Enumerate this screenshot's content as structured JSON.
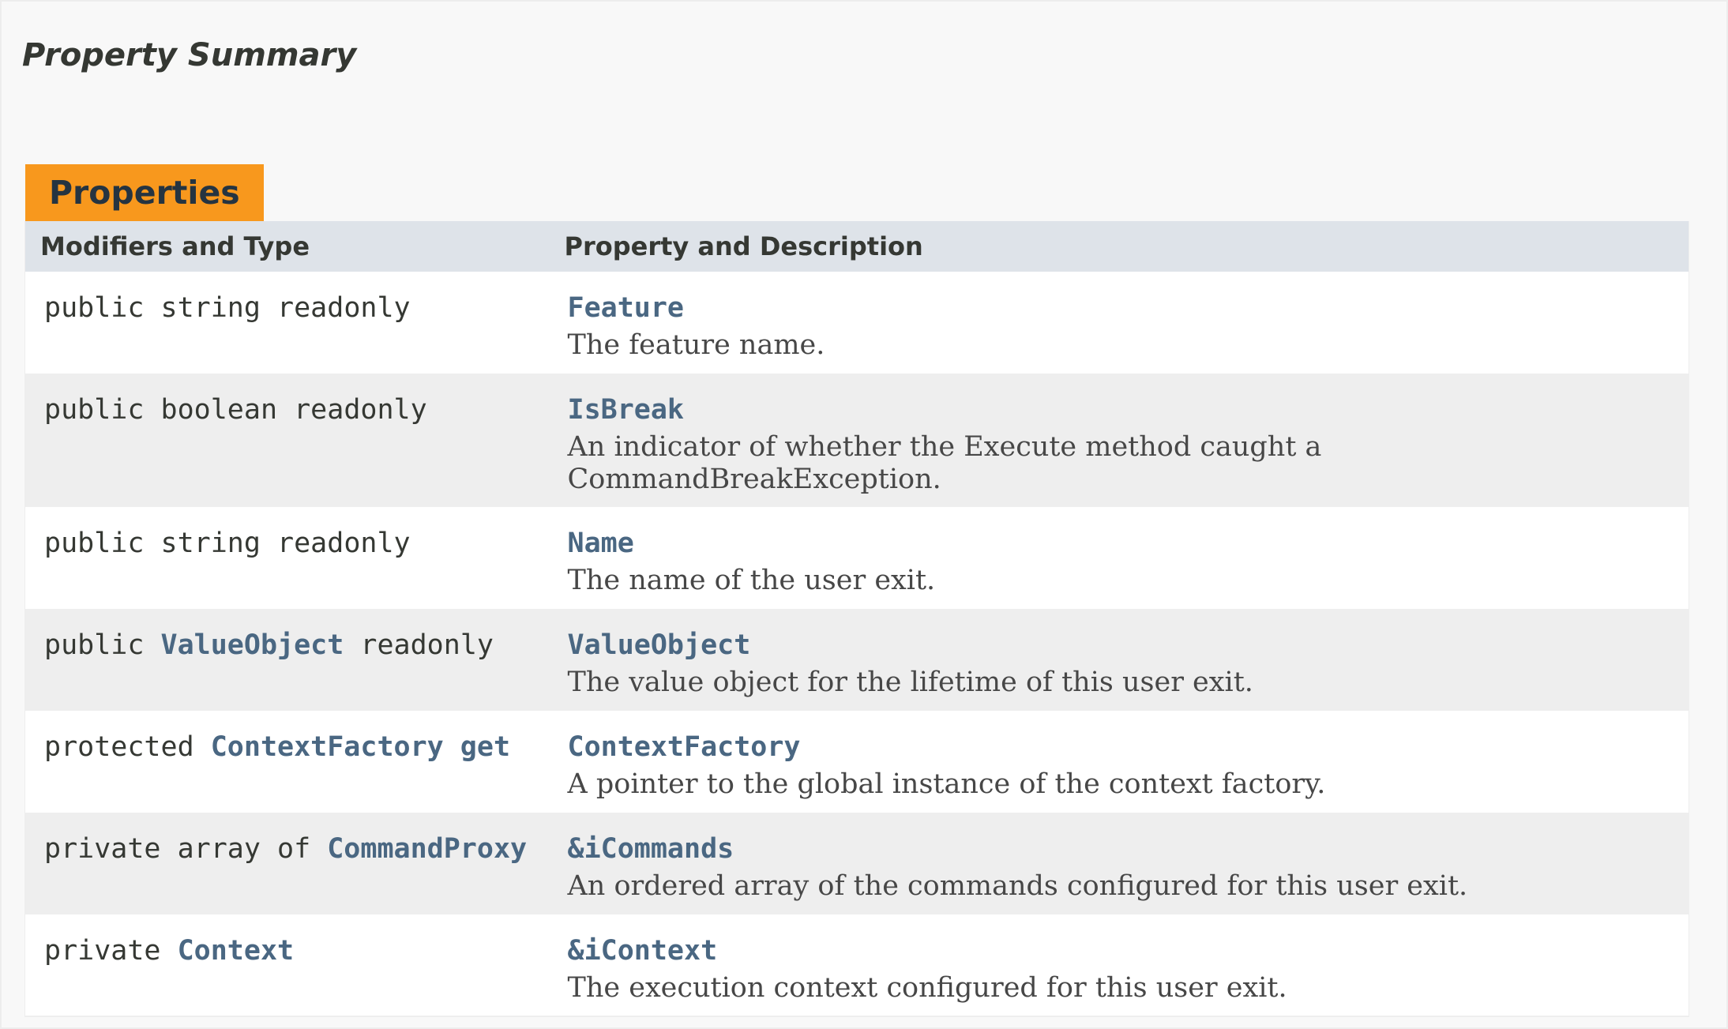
{
  "summary": {
    "title": "Property Summary"
  },
  "table": {
    "caption": "Properties",
    "headers": {
      "type": "Modifiers and Type",
      "property": "Property and Description"
    },
    "rows": [
      {
        "modifier": "public",
        "type": "string",
        "type_is_link": false,
        "suffix": "readonly",
        "name": "Feature",
        "description": "The feature name."
      },
      {
        "modifier": "public",
        "type": "boolean",
        "type_is_link": false,
        "suffix": "readonly",
        "name": "IsBreak",
        "description": "An indicator of whether the Execute method caught a CommandBreakException."
      },
      {
        "modifier": "public",
        "type": "string",
        "type_is_link": false,
        "suffix": "readonly",
        "name": "Name",
        "description": "The name of the user exit."
      },
      {
        "modifier": "public",
        "type": "ValueObject",
        "type_is_link": true,
        "suffix": "readonly",
        "name": "ValueObject",
        "description": "The value object for the lifetime of this user exit."
      },
      {
        "modifier": "protected",
        "type": "ContextFactory get",
        "type_is_link": true,
        "suffix": "",
        "name": "ContextFactory",
        "description": "A pointer to the global instance of the context factory."
      },
      {
        "modifier": "private array of",
        "type": "CommandProxy",
        "type_is_link": true,
        "suffix": "",
        "name": "&iCommands",
        "description": "An ordered array of the commands configured for this user exit."
      },
      {
        "modifier": "private",
        "type": "Context",
        "type_is_link": true,
        "suffix": "",
        "name": "&iContext",
        "description": "The execution context configured for this user exit."
      }
    ]
  },
  "colors": {
    "caption_bg": "#f8981d",
    "header_bg": "#dee3e9",
    "link": "#4a6782",
    "row_alt_bg": "#eeeeee"
  }
}
